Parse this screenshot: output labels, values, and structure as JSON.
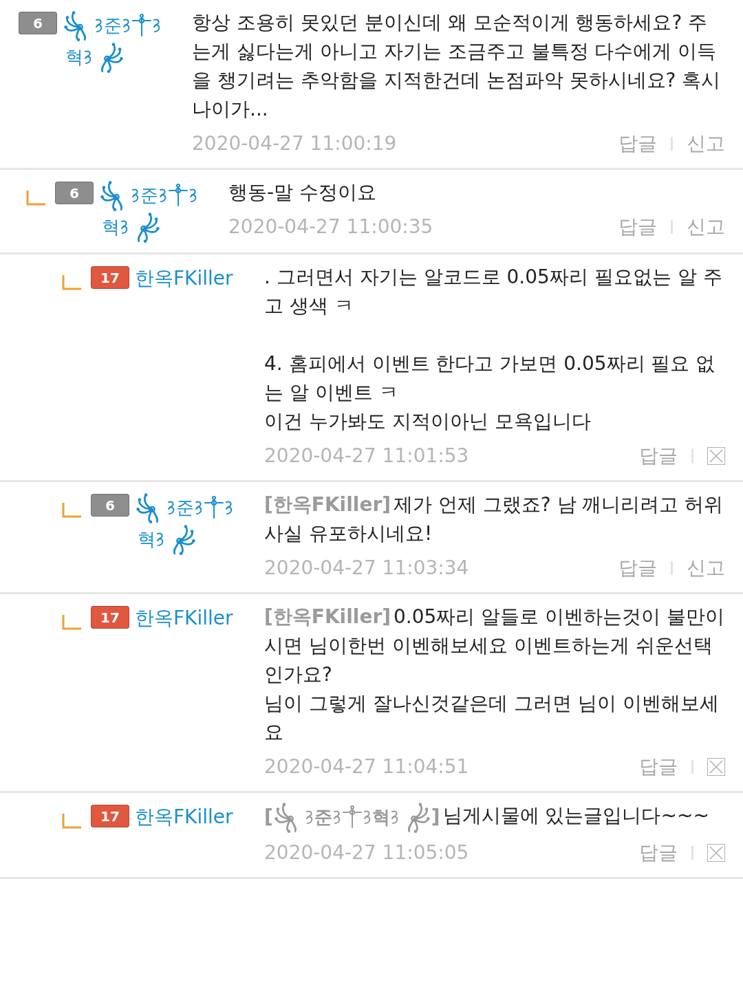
{
  "comments": [
    {
      "badge": {
        "text": "6",
        "color": "#8e8e8e"
      },
      "nickname": {
        "kind": "decorated",
        "parts": [
          "준",
          "혁"
        ]
      },
      "paragraphs": [
        [
          "항상 조용히 못있던 분이신데 왜 모순적이게 행동하세요? 주는게 싫다는게 아니고 자기는 조금주고 불특정 다수에게 이득을 챙기려는 추악함을 지적한건데 논점파악 못하시네요? 혹시 나이가..."
        ]
      ],
      "date": "2020-04-27 11:00:19",
      "actions": [
        {
          "kind": "text",
          "label": "답글"
        },
        {
          "kind": "text",
          "label": "신고"
        }
      ],
      "children": [
        {
          "badge": {
            "text": "6",
            "color": "#8e8e8e"
          },
          "nickname": {
            "kind": "decorated",
            "parts": [
              "준",
              "혁"
            ]
          },
          "paragraphs": [
            [
              "행동-말 수정이요"
            ]
          ],
          "date": "2020-04-27 11:00:35",
          "actions": [
            {
              "kind": "text",
              "label": "답글"
            },
            {
              "kind": "text",
              "label": "신고"
            }
          ],
          "children": [
            {
              "badge": {
                "text": "17",
                "color": "#e0583f"
              },
              "nickname": {
                "kind": "plain",
                "text": "한옥FKiller"
              },
              "paragraphs": [
                [
                  ". 그러면서 자기는 알코드로 0.05짜리 필요없는 알 주고 생색 ㅋ"
                ],
                [
                  "4. 홈피에서 이벤트 한다고 가보면 0.05짜리 필요 없는 알 이벤트 ㅋ",
                  "이건 누가봐도 지적이아닌 모욕입니다"
                ]
              ],
              "date": "2020-04-27 11:01:53",
              "actions": [
                {
                  "kind": "text",
                  "label": "답글"
                },
                {
                  "kind": "delete"
                }
              ]
            },
            {
              "badge": {
                "text": "6",
                "color": "#8e8e8e"
              },
              "nickname": {
                "kind": "decorated",
                "parts": [
                  "준",
                  "혁"
                ]
              },
              "mention": {
                "open": "[",
                "close": "]",
                "nickname": {
                  "kind": "plain",
                  "text": "한옥FKiller"
                }
              },
              "paragraphs": [
                [
                  "제가 언제 그랬죠? 남 깨니리려고 허위사실 유포하시네요!"
                ]
              ],
              "date": "2020-04-27 11:03:34",
              "actions": [
                {
                  "kind": "text",
                  "label": "답글"
                },
                {
                  "kind": "text",
                  "label": "신고"
                }
              ]
            },
            {
              "badge": {
                "text": "17",
                "color": "#e0583f"
              },
              "nickname": {
                "kind": "plain",
                "text": "한옥FKiller"
              },
              "mention": {
                "open": "[",
                "close": "]",
                "nickname": {
                  "kind": "plain",
                  "text": "한옥FKiller"
                }
              },
              "paragraphs": [
                [
                  "0.05짜리 알들로 이벤하는것이 불만이시면 님이한번 이벤해보세요 이벤트하는게 쉬운선택인가요?",
                  "님이 그렇게 잘나신것같은데 그러면 님이 이벤해보세요"
                ]
              ],
              "date": "2020-04-27 11:04:51",
              "actions": [
                {
                  "kind": "text",
                  "label": "답글"
                },
                {
                  "kind": "delete"
                }
              ]
            },
            {
              "badge": {
                "text": "17",
                "color": "#e0583f"
              },
              "nickname": {
                "kind": "plain",
                "text": "한옥FKiller"
              },
              "mention": {
                "open": "[",
                "close": "]",
                "nickname": {
                  "kind": "decorated",
                  "parts": [
                    "준",
                    "혁"
                  ]
                }
              },
              "paragraphs": [
                [
                  "님게시물에 있는글입니다~~~"
                ]
              ],
              "date": "2020-04-27 11:05:05",
              "actions": [
                {
                  "kind": "text",
                  "label": "답글"
                },
                {
                  "kind": "delete"
                }
              ]
            }
          ]
        }
      ]
    }
  ]
}
